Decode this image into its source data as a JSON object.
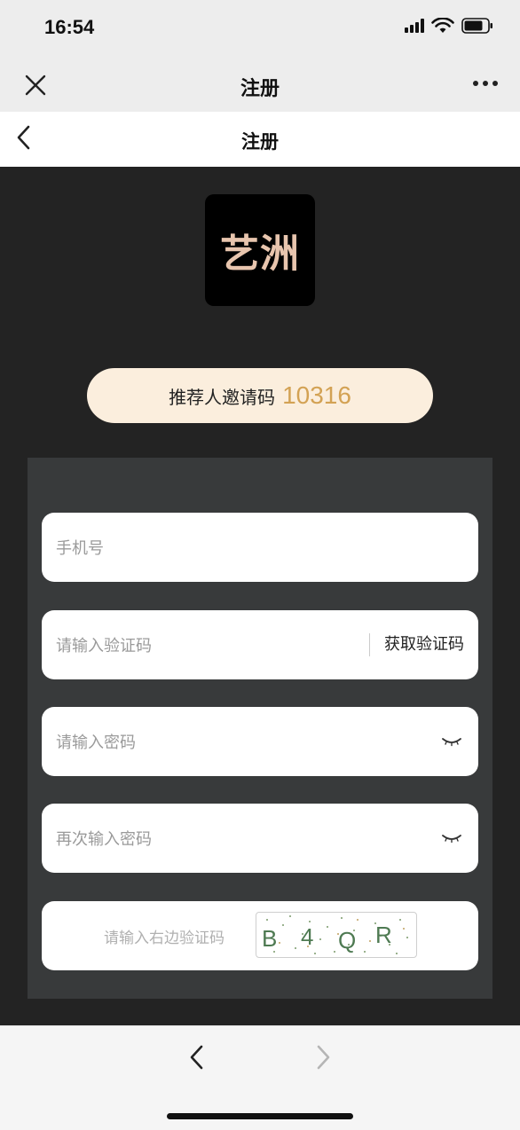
{
  "status_bar": {
    "time": "16:54"
  },
  "wechat_bar": {
    "title": "注册"
  },
  "page_nav": {
    "title": "注册"
  },
  "logo": {
    "text": "艺洲"
  },
  "invite": {
    "label": "推荐人邀请码",
    "code": "10316"
  },
  "form": {
    "phone_placeholder": "手机号",
    "sms_code_placeholder": "请输入验证码",
    "get_code_label": "获取验证码",
    "password_placeholder": "请输入密码",
    "confirm_password_placeholder": "再次输入密码",
    "captcha_placeholder": "请输入右边验证码",
    "captcha_chars": [
      "B",
      "4",
      "Q",
      "R"
    ]
  },
  "colors": {
    "main_bg": "#232323",
    "panel_bg": "#383a3b",
    "pill_bg": "#fbeedd",
    "accent": "#d3a254",
    "logo_text": "#e8c5ae"
  },
  "icons": [
    "close-icon",
    "more-icon",
    "back-chevron-icon",
    "eye-closed-icon",
    "nav-back-icon",
    "nav-forward-icon",
    "signal-icon",
    "wifi-icon",
    "battery-icon"
  ]
}
